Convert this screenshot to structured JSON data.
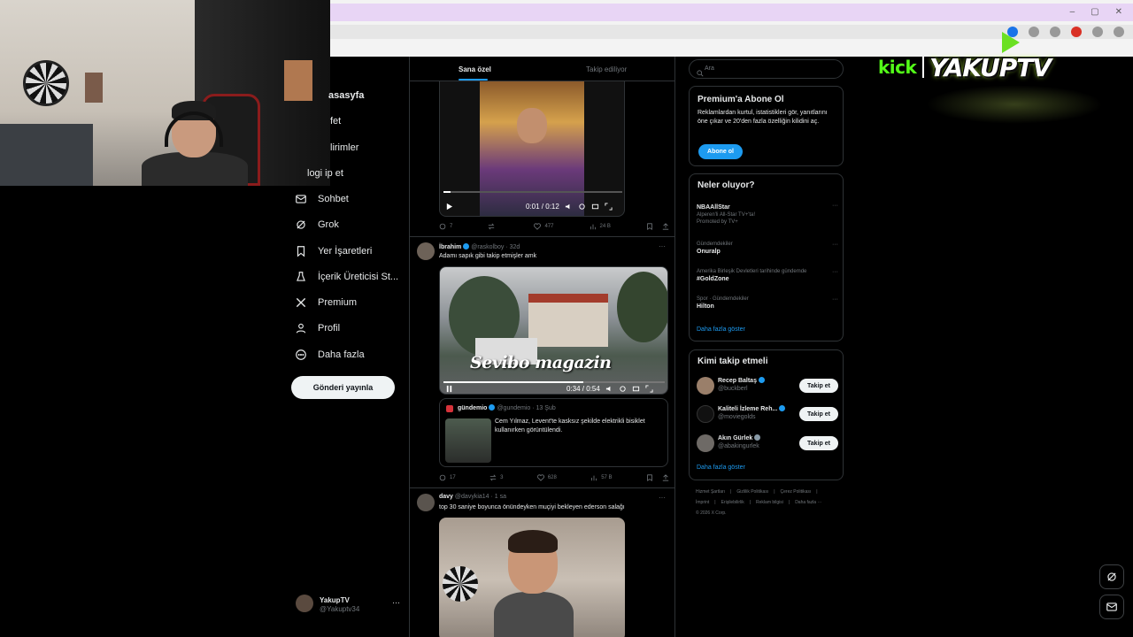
{
  "browser": {
    "window_controls": [
      "–",
      "▢",
      "✕"
    ]
  },
  "nav": {
    "partial_items": [
      {
        "text": "asasyfa",
        "bold": true
      },
      {
        "text": "fet"
      },
      {
        "text": "lirimler"
      },
      {
        "text": "logi ip et"
      }
    ],
    "items": [
      {
        "label": "Sohbet",
        "icon": "mail-icon"
      },
      {
        "label": "Grok",
        "icon": "grok-icon"
      },
      {
        "label": "Yer İşaretleri",
        "icon": "bookmark-icon"
      },
      {
        "label": "İçerik Üreticisi St...",
        "icon": "creator-icon"
      },
      {
        "label": "Premium",
        "icon": "x-logo-icon"
      },
      {
        "label": "Profil",
        "icon": "person-icon"
      },
      {
        "label": "Daha fazla",
        "icon": "more-circle-icon"
      }
    ],
    "post_button": "Gönderi yayınla",
    "account": {
      "name": "YakupTV",
      "handle": "@Yakuptv34",
      "more": "···"
    }
  },
  "feed": {
    "tabs": [
      "Sana özel",
      "Takip ediliyor"
    ],
    "post1": {
      "video_time": "0:01 / 0:12",
      "stats": {
        "replies": "7",
        "retweets": "",
        "likes": "477",
        "views": "24 B"
      }
    },
    "post2": {
      "name": "İbrahim",
      "handle": "@raskolboy",
      "time": "· 32d",
      "text": "Adamı sapık gibi takip etmişler amk",
      "video_caption": "Sevibo magazin",
      "video_time": "0:34 / 0:54",
      "progress": 0.63,
      "quote": {
        "name": "gündemio",
        "handle": "@gundemio",
        "time": "· 13 Şub",
        "text": "Cem Yılmaz, Levent'te kasksız şekilde elektrikli bisiklet kullanırken görüntülendi."
      },
      "stats": {
        "replies": "17",
        "retweets": "3",
        "likes": "628",
        "views": "57 B"
      }
    },
    "post3": {
      "name": "davy",
      "handle": "@davykia14",
      "time": "· 1 sa",
      "text": "top 30 saniye boyunca önündeyken muçiyi bekleyen ederson salağı"
    },
    "more": "···"
  },
  "sidebar": {
    "search_placeholder": "Ara",
    "premium": {
      "title": "Premium'a Abone Ol",
      "body": "Reklamlardan kurtul, istatistikleri gör, yanıtlarını öne çıkar ve 20'den fazla özelliğin kilidini aç.",
      "button": "Abone ol"
    },
    "trends": {
      "title": "Neler oluyor?",
      "items": [
        {
          "meta": "",
          "title": "NBAAllStar",
          "sub": "Alperen'li All-Star TV+'ta!",
          "promo": "Promoted by TV+"
        },
        {
          "meta": "Gündemdekiler",
          "title": "Onuralp",
          "sub": "",
          "promo": ""
        },
        {
          "meta": "Amerika Birleşik Devletleri tarihinde gündemde",
          "title": "#GoldZone",
          "sub": "",
          "promo": ""
        },
        {
          "meta": "Spor · Gündemdekiler",
          "title": "Hilton",
          "sub": "",
          "promo": ""
        }
      ],
      "show_more": "Daha fazla göster"
    },
    "follow": {
      "title": "Kimi takip etmeli",
      "items": [
        {
          "name": "Recep Baltaş",
          "handle": "@buckberl",
          "button": "Takip et"
        },
        {
          "name": "Kaliteli İzleme Reh...",
          "handle": "@moviegolds",
          "button": "Takip et"
        },
        {
          "name": "Akın Gürlek",
          "handle": "@abakingurlek",
          "button": "Takip et"
        }
      ],
      "show_more": "Daha fazla göster"
    },
    "footer": {
      "line1": [
        "Hizmet Şartları",
        "|",
        "Gizlilik Politikası",
        "|",
        "Çerez Politikası",
        "|"
      ],
      "line2": [
        "İmprint",
        "|",
        "Erişilebilirlik",
        "|",
        "Reklam bilgisi",
        "|",
        "Daha fazla ···"
      ],
      "line3": "© 2026 X Corp."
    }
  },
  "overlay": {
    "kick": "kick",
    "brand": "YAKUPTV"
  },
  "colors": {
    "accent": "#1d9bf0",
    "kick_green": "#53fc18",
    "background": "#000000",
    "border": "#2f3336"
  }
}
